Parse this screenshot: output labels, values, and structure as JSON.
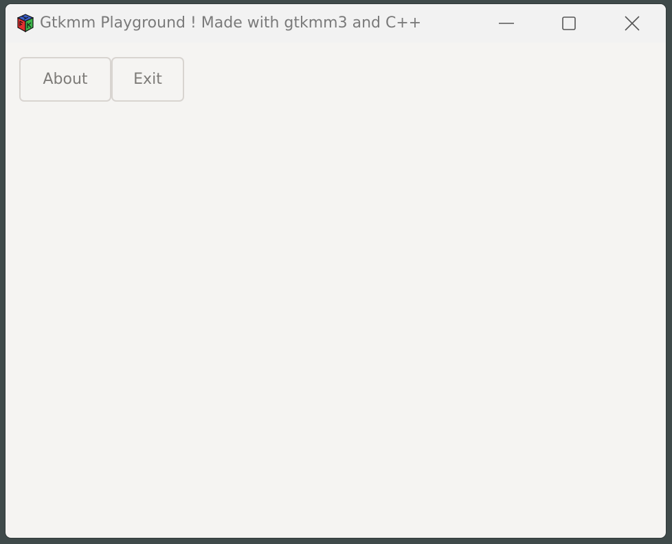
{
  "window": {
    "title": "Gtkmm Playground ! Made with gtkmm3 and C++",
    "icon": "gtk-cube-icon",
    "controls": {
      "minimize": "minimize-icon",
      "maximize": "maximize-icon",
      "close": "close-icon"
    }
  },
  "toolbar": {
    "about_label": "About",
    "exit_label": "Exit"
  },
  "colors": {
    "window_bg": "#f5f4f2",
    "titlebar_bg": "#f2f2f2",
    "desktop_bg": "#3f4a4a",
    "text": "#7a7a7a",
    "button_border": "#d8d4d0"
  }
}
